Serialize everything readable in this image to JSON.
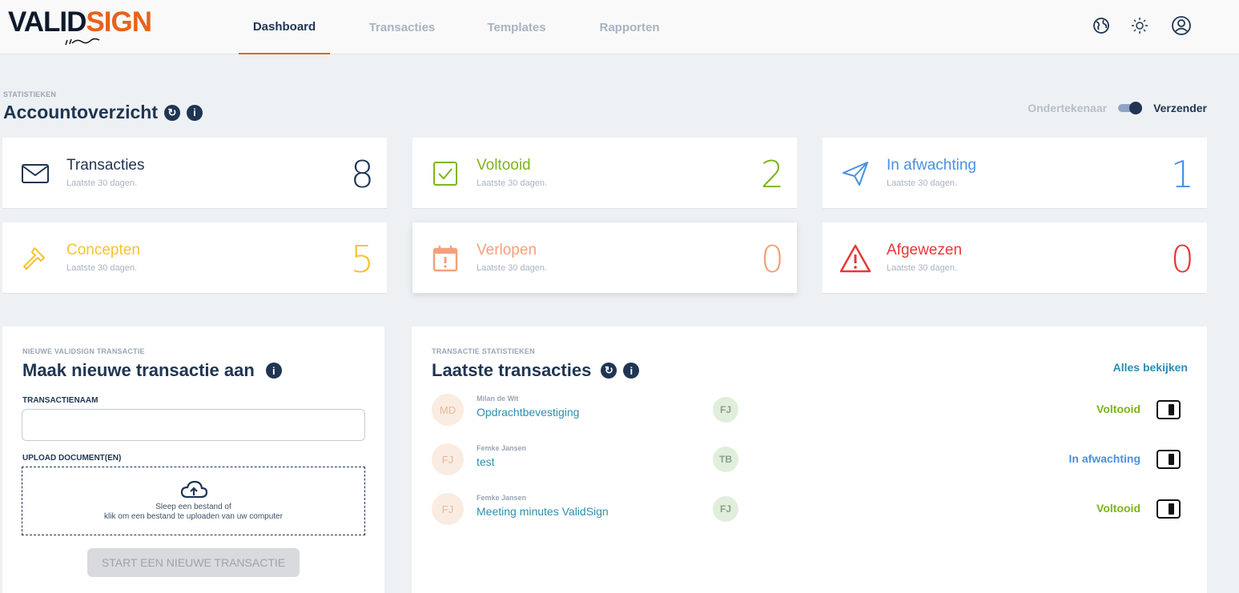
{
  "brand": {
    "logo_part1": "VALID",
    "logo_part2": "SIGN"
  },
  "nav": [
    {
      "label": "Dashboard",
      "active": true
    },
    {
      "label": "Transacties",
      "active": false
    },
    {
      "label": "Templates",
      "active": false
    },
    {
      "label": "Rapporten",
      "active": false
    }
  ],
  "header_icons": [
    "globe-icon",
    "sun-icon",
    "user-icon"
  ],
  "overview": {
    "kicker": "STATISTIEKEN",
    "title": "Accountoverzicht",
    "toggle_left": "Ondertekenaar",
    "toggle_right": "Verzender",
    "toggle_value": "Verzender"
  },
  "stat_cards": [
    {
      "label": "Transacties",
      "sub": "Laatste 30 dagen.",
      "value": "8",
      "color": "#1f3553",
      "icon": "envelope-icon"
    },
    {
      "label": "Voltooid",
      "sub": "Laatste 30 dagen.",
      "value": "2",
      "color": "#7cb518",
      "icon": "checkbox-icon"
    },
    {
      "label": "In afwachting",
      "sub": "Laatste 30 dagen.",
      "value": "1",
      "color": "#4a90e2",
      "icon": "paper-plane-icon"
    },
    {
      "label": "Concepten",
      "sub": "Laatste 30 dagen.",
      "value": "5",
      "color": "#f5c232",
      "icon": "hammer-icon"
    },
    {
      "label": "Verlopen",
      "sub": "Laatste 30 dagen.",
      "value": "0",
      "color": "#f5a07a",
      "icon": "calendar-alert-icon"
    },
    {
      "label": "Afgewezen",
      "sub": "Laatste 30 dagen.",
      "value": "0",
      "color": "#e53935",
      "icon": "warning-icon"
    }
  ],
  "new_transaction": {
    "kicker": "NIEUWE VALIDSIGN TRANSACTIE",
    "title": "Maak nieuwe transactie aan",
    "name_label": "TRANSACTIENAAM",
    "name_value": "",
    "upload_label": "UPLOAD DOCUMENT(EN)",
    "upload_line1": "Sleep een bestand of",
    "upload_line2": "klik om een bestand te uploaden van uw computer",
    "start_button": "START EEN NIEUWE TRANSACTIE"
  },
  "latest": {
    "kicker": "TRANSACTIE STATISTIEKEN",
    "title": "Laatste transacties",
    "view_all": "Alles bekijken",
    "rows": [
      {
        "initials": "MD",
        "sender": "Milan de Wit",
        "name": "Opdrachtbevestiging",
        "signer": "FJ",
        "status": "Voltooid",
        "status_color": "#7cb518"
      },
      {
        "initials": "FJ",
        "sender": "Femke Jansen",
        "name": "test",
        "signer": "TB",
        "status": "In afwachting",
        "status_color": "#4a90e2"
      },
      {
        "initials": "FJ",
        "sender": "Femke Jansen",
        "name": "Meeting minutes ValidSign",
        "signer": "FJ",
        "status": "Voltooid",
        "status_color": "#7cb518"
      }
    ]
  }
}
